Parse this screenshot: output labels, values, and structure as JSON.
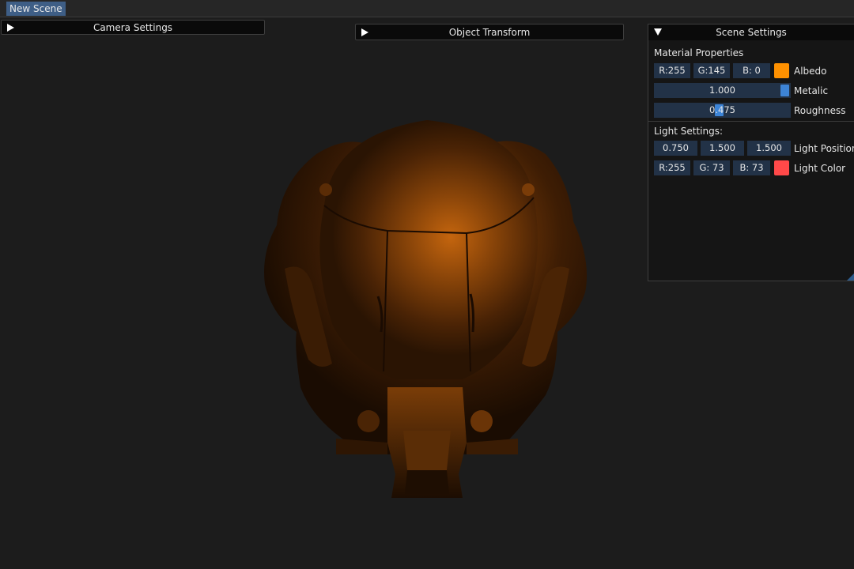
{
  "menubar": {
    "items": [
      {
        "label": "New Scene"
      }
    ]
  },
  "camera_window": {
    "title": "Camera Settings"
  },
  "object_window": {
    "title": "Object Transform"
  },
  "scene_window": {
    "title": "Scene Settings",
    "material": {
      "heading": "Material Properties",
      "albedo": {
        "r": "R:255",
        "g": "G:145",
        "b": "B:  0",
        "color": "#ff9100",
        "label": "Albedo"
      },
      "metalic": {
        "value": "1.000",
        "fraction": 1.0,
        "label": "Metalic"
      },
      "roughness": {
        "value": "0.475",
        "fraction": 0.475,
        "label": "Roughness"
      }
    },
    "light": {
      "heading": "Light Settings:",
      "position": {
        "x": "0.750",
        "y": "1.500",
        "z": "1.500",
        "label": "Light Position"
      },
      "color": {
        "r": "R:255",
        "g": "G: 73",
        "b": "B: 73",
        "color": "#ff4949",
        "label": "Light Color"
      }
    }
  },
  "colors": {
    "background": "#1c1c1c",
    "helmet_highlight": "#c8600a",
    "helmet_shadow": "#120802",
    "accent": "#3d84d6"
  }
}
